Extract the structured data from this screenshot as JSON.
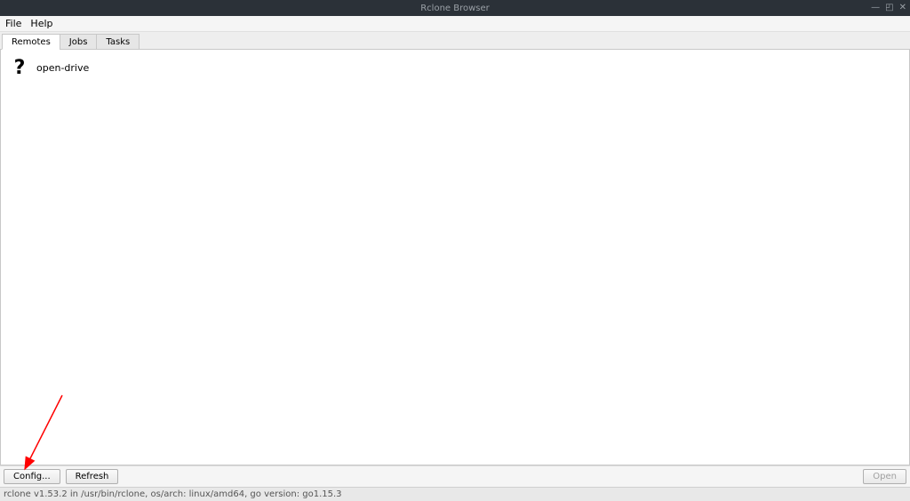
{
  "titlebar": {
    "title": "Rclone Browser"
  },
  "menubar": {
    "items": [
      "File",
      "Help"
    ]
  },
  "tabs": [
    {
      "label": "Remotes",
      "active": true
    },
    {
      "label": "Jobs",
      "active": false
    },
    {
      "label": "Tasks",
      "active": false
    }
  ],
  "remotes": [
    {
      "name": "open-drive",
      "icon": "question-mark-icon"
    }
  ],
  "buttons": {
    "config": "Config...",
    "refresh": "Refresh",
    "open": "Open"
  },
  "status": "rclone v1.53.2 in /usr/bin/rclone, os/arch: linux/amd64, go version: go1.15.3"
}
